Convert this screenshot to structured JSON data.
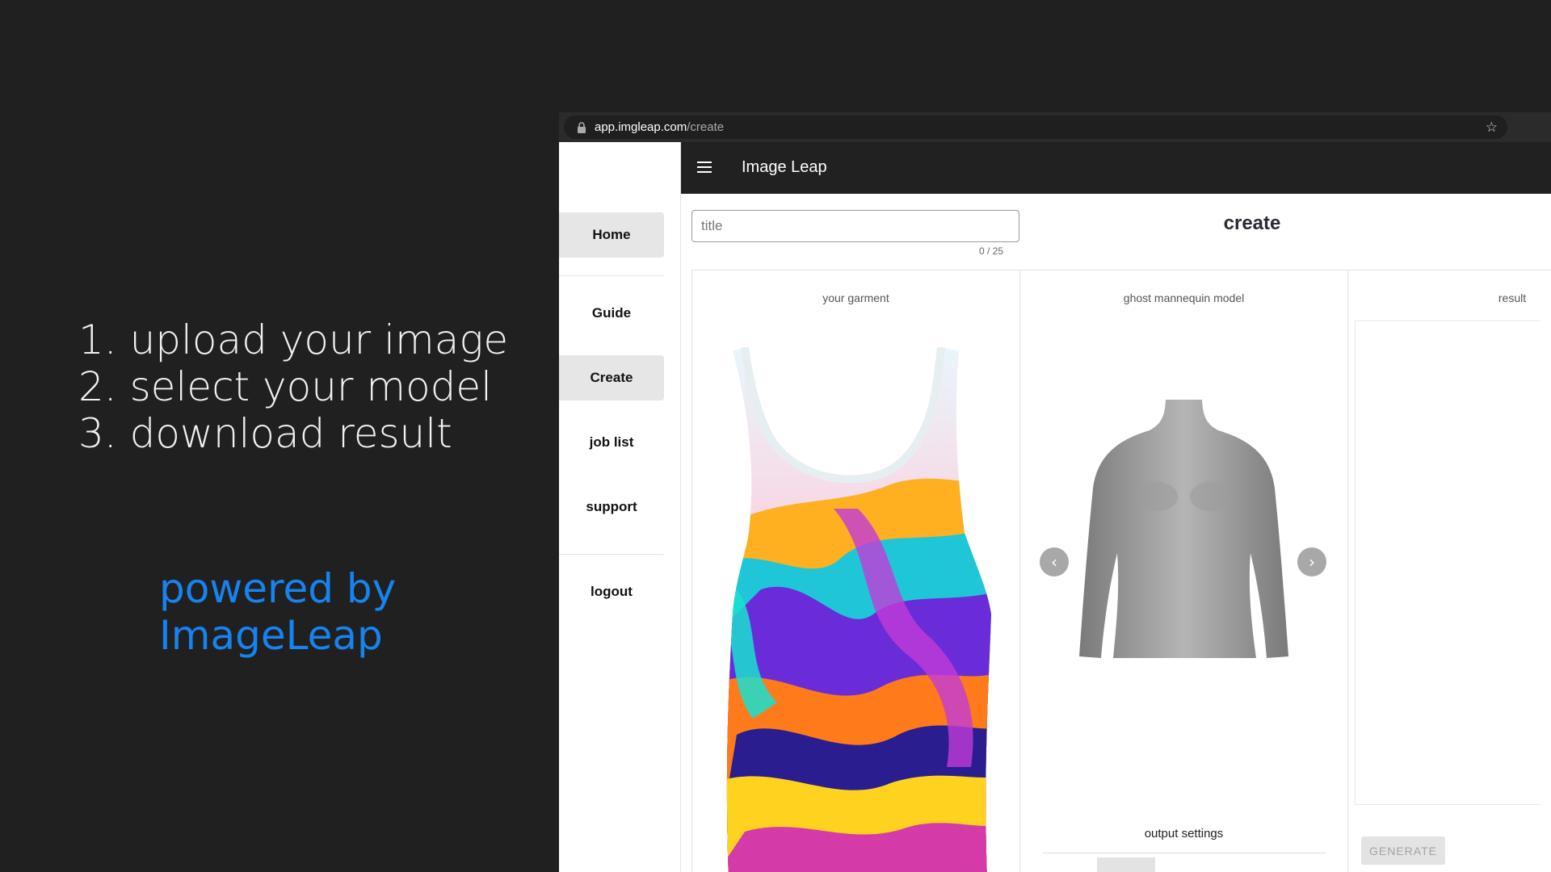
{
  "promo": {
    "steps": [
      "1. upload your image",
      "2. select your model",
      "3. download result"
    ],
    "powered_line1": "powered by",
    "powered_line2": "ImageLeap"
  },
  "browser": {
    "url_host": "app.imgleap.com",
    "url_path": "/create"
  },
  "sidebar": {
    "items": [
      {
        "label": "Home"
      },
      {
        "label": "Guide"
      },
      {
        "label": "Create"
      },
      {
        "label": "job list"
      },
      {
        "label": "support"
      },
      {
        "label": "logout"
      }
    ]
  },
  "header": {
    "app_title": "Image Leap"
  },
  "main": {
    "title_placeholder": "title",
    "title_counter": "0 / 25",
    "page_title": "create",
    "panels": {
      "garment_label": "your garment",
      "model_label": "ghost mannequin model",
      "result_label": "result",
      "output_settings": "output settings",
      "generate_label": "GENERATE"
    }
  },
  "colors": {
    "background": "#202020",
    "accent": "#1683f0",
    "appbar": "#212121",
    "active_nav": "#e6e6e6"
  }
}
